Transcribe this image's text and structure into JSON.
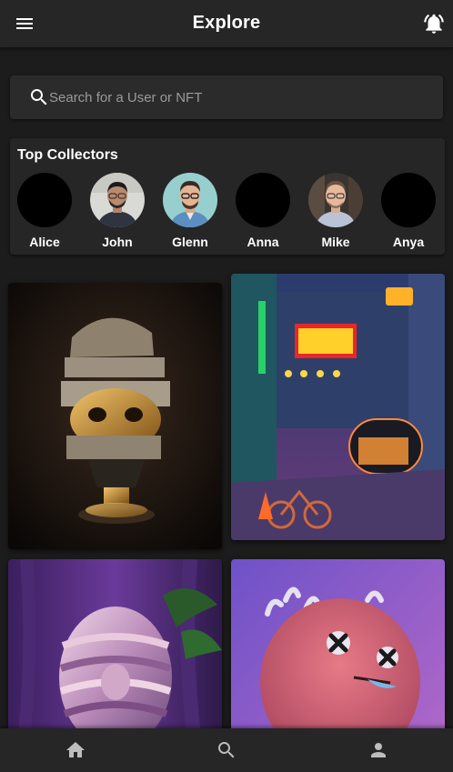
{
  "header": {
    "title": "Explore",
    "menu_icon": "menu-icon",
    "notification_icon": "notifications-active-icon"
  },
  "search": {
    "placeholder": "Search for a User or NFT",
    "value": "",
    "icon": "search-icon"
  },
  "collectors": {
    "title": "Top Collectors",
    "items": [
      {
        "name": "Alice"
      },
      {
        "name": "John"
      },
      {
        "name": "Glenn"
      },
      {
        "name": "Anna"
      },
      {
        "name": "Mike"
      },
      {
        "name": "Anya"
      }
    ]
  },
  "nfts": [
    {
      "subject": "golden-skull-bust"
    },
    {
      "subject": "neon-city-street"
    },
    {
      "subject": "chrome-wrapped-head"
    },
    {
      "subject": "pink-furry-monster"
    }
  ],
  "bottom_nav": {
    "items": [
      {
        "icon": "home-icon"
      },
      {
        "icon": "search-icon"
      },
      {
        "icon": "person-icon"
      }
    ]
  },
  "colors": {
    "background": "#1c1c1c",
    "surface": "#262626",
    "text": "#ffffff",
    "muted": "#9a9a9a"
  }
}
